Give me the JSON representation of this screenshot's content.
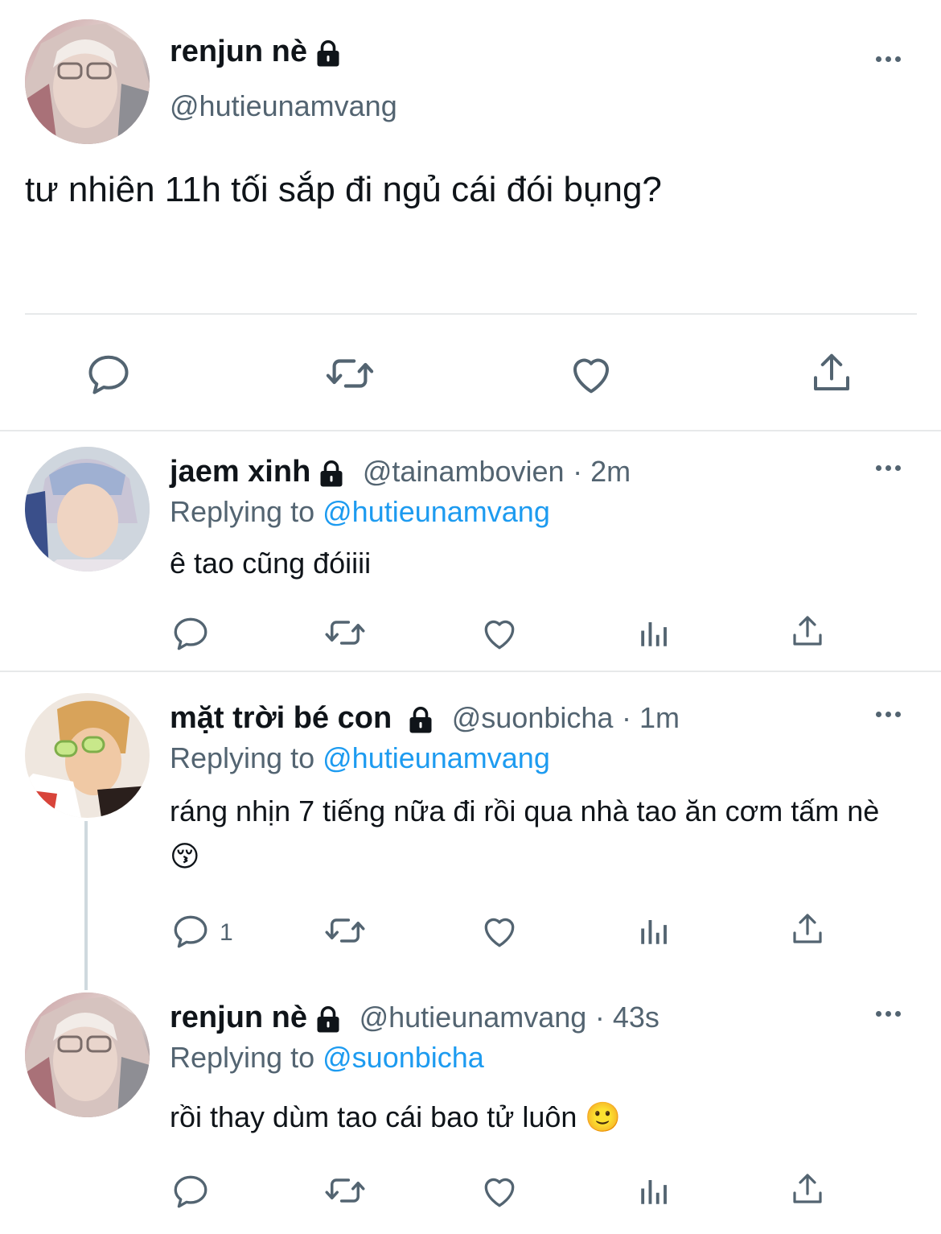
{
  "main_tweet": {
    "display_name": "renjun nè",
    "handle": "@hutieunamvang",
    "text": "tư nhiên 11h tối sắp đi ngủ cái đói bụng?"
  },
  "replies": [
    {
      "display_name": "jaem xinh",
      "handle": "@tainambovien",
      "time": "· 2m",
      "replying_label": "Replying to",
      "replying_to": "@hutieunamvang",
      "text": "ê tao cũng đóiiii",
      "reply_count": ""
    },
    {
      "display_name": "mặt trời bé con",
      "handle": "@suonbicha",
      "time": "· 1m",
      "replying_label": "Replying to",
      "replying_to": "@hutieunamvang",
      "text": "ráng nhịn 7 tiếng nữa đi rồi qua nhà tao ăn cơm tấm nè 😚",
      "reply_count": "1"
    },
    {
      "display_name": "renjun nè",
      "handle": "@hutieunamvang",
      "time": "· 43s",
      "replying_label": "Replying to",
      "replying_to": "@suonbicha",
      "text": "rồi thay dùm tao cái bao tử luôn 🙂",
      "reply_count": ""
    }
  ],
  "icons": [
    "reply-icon",
    "retweet-icon",
    "like-icon",
    "share-icon",
    "analytics-icon",
    "lock-icon",
    "more-icon"
  ],
  "colors": {
    "text": "#0f1419",
    "secondary": "#536471",
    "link": "#1d9bf0",
    "divider": "#e7e9ea"
  }
}
